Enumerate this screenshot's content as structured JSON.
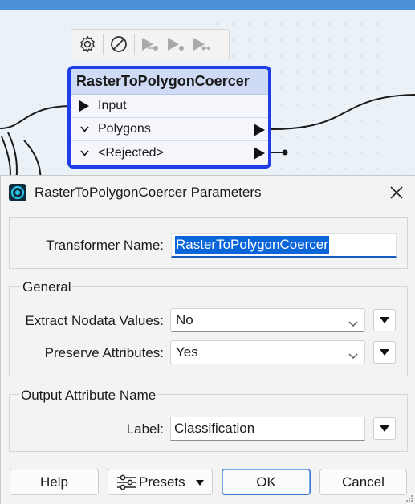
{
  "canvas": {
    "toolbar": {
      "icons": [
        "gear-icon",
        "disable-icon",
        "run-to-this-icon",
        "run-from-this-icon",
        "run-and-inspect-icon"
      ]
    },
    "node": {
      "title": "RasterToPolygonCoercer",
      "ports": {
        "input": "Input",
        "polygons": "Polygons",
        "rejected": "<Rejected>"
      },
      "border_color": "#1f3ee8"
    }
  },
  "dialog": {
    "title": "RasterToPolygonCoercer Parameters",
    "transformer_name_label": "Transformer Name:",
    "transformer_name_value": "RasterToPolygonCoercer",
    "general": {
      "title": "General",
      "extract_nodata_label": "Extract Nodata Values:",
      "extract_nodata_value": "No",
      "preserve_attributes_label": "Preserve Attributes:",
      "preserve_attributes_value": "Yes"
    },
    "output_attr": {
      "title": "Output Attribute Name",
      "label_label": "Label:",
      "label_value": "Classification"
    },
    "buttons": {
      "help": "Help",
      "presets": "Presets",
      "ok": "OK",
      "cancel": "Cancel"
    },
    "accent_color": "#1a5bbf"
  }
}
